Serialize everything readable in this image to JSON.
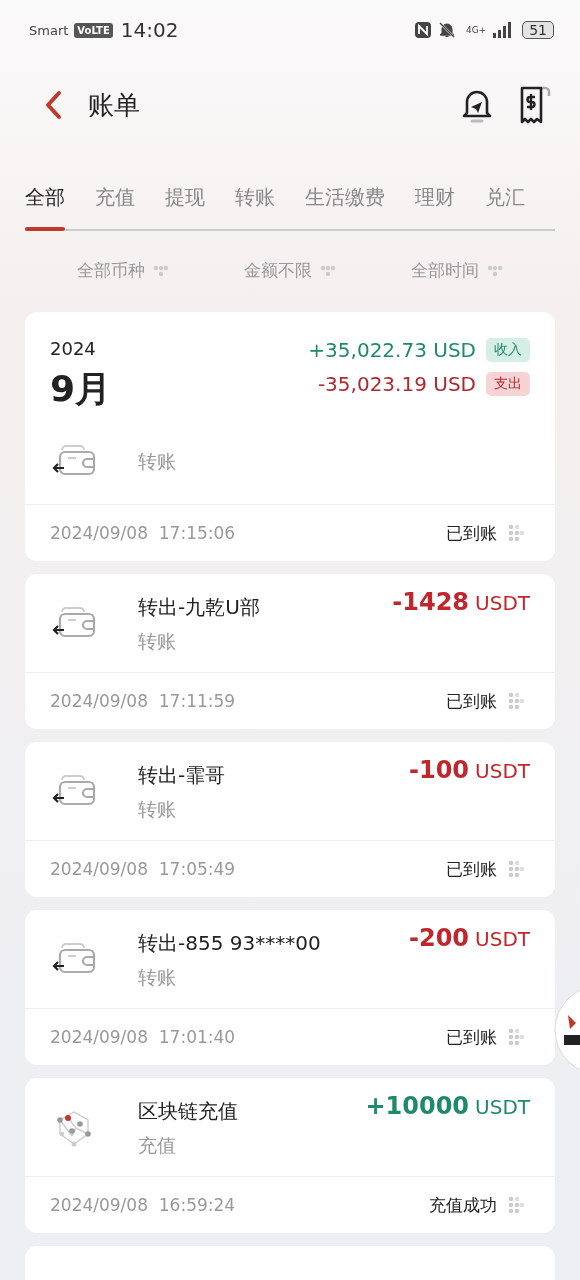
{
  "status_bar": {
    "carrier": "Smart",
    "volte": "VoLTE",
    "time": "14:02",
    "network": "4G+",
    "battery": "51"
  },
  "header": {
    "title": "账单"
  },
  "tabs": [
    {
      "label": "全部",
      "selected": true
    },
    {
      "label": "充值",
      "selected": false
    },
    {
      "label": "提现",
      "selected": false
    },
    {
      "label": "转账",
      "selected": false
    },
    {
      "label": "生活缴费",
      "selected": false
    },
    {
      "label": "理财",
      "selected": false
    },
    {
      "label": "兑汇",
      "selected": false
    }
  ],
  "filters": [
    "全部币种",
    "金额不限",
    "全部时间"
  ],
  "month": {
    "year": "2024",
    "month": "9月",
    "income": "+35,022.73 USD",
    "income_tag": "收入",
    "expense": "-35,023.19 USD",
    "expense_tag": "支出"
  },
  "transactions": [
    {
      "kind": "transfer",
      "subtitle": "转账",
      "datetime": "2024/09/08  17:15:06",
      "status": "已到账"
    },
    {
      "kind": "transfer",
      "income": false,
      "title": "转出-九乾U部",
      "amount": "-1428",
      "unit": "USDT",
      "subtitle": "转账",
      "datetime": "2024/09/08  17:11:59",
      "status": "已到账"
    },
    {
      "kind": "transfer",
      "income": false,
      "title": "转出-霏哥",
      "amount": "-100",
      "unit": "USDT",
      "subtitle": "转账",
      "datetime": "2024/09/08  17:05:49",
      "status": "已到账"
    },
    {
      "kind": "transfer",
      "income": false,
      "title": "转出-855 93****00",
      "amount": "-200",
      "unit": "USDT",
      "subtitle": "转账",
      "datetime": "2024/09/08  17:01:40",
      "status": "已到账"
    },
    {
      "kind": "deposit",
      "income": true,
      "title": "区块链充值",
      "amount": "+10000",
      "unit": "USDT",
      "subtitle": "充值",
      "datetime": "2024/09/08  16:59:24",
      "status": "充值成功"
    }
  ]
}
